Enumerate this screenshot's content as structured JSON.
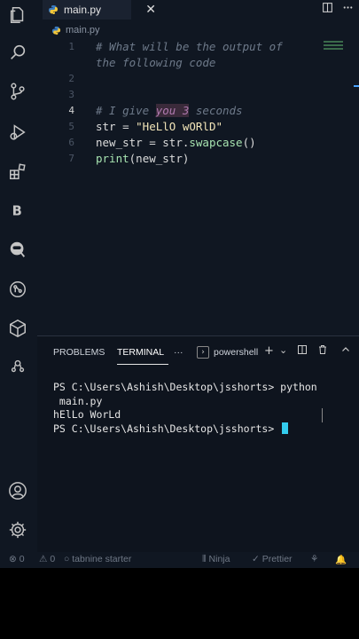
{
  "tab": {
    "filename": "main.py",
    "close_glyph": "✕"
  },
  "breadcrumb": {
    "file": "main.py"
  },
  "activity_icons": [
    "files-icon",
    "search-icon",
    "source-control-icon",
    "run-debug-icon",
    "extensions-icon",
    "bootstrap-icon",
    "ninja-icon",
    "git-graph-icon",
    "cube-icon",
    "docker-icon"
  ],
  "editor": {
    "lines": [
      {
        "num": "1",
        "comment": "# What will be the output of"
      },
      {
        "num": "",
        "comment": "the following code"
      },
      {
        "num": "2"
      },
      {
        "num": "3"
      },
      {
        "num": "4",
        "comment_a": "# I give ",
        "comment_b": "you 3",
        "comment_c": " seconds"
      },
      {
        "num": "5",
        "var": "str",
        "op": " = ",
        "string": "\"HeLlO wORlD\""
      },
      {
        "num": "6",
        "var": "new_str",
        "op": " = ",
        "obj": "str.",
        "method": "swapcase",
        "tail": "()"
      },
      {
        "num": "7",
        "fn": "print",
        "args": "(new_str)"
      }
    ]
  },
  "panel": {
    "tabs": {
      "problems": "PROBLEMS",
      "terminal": "TERMINAL",
      "more": "···"
    },
    "shell": "powershell",
    "shell_icon": "›",
    "buttons": {
      "add": "+",
      "dropdown": "⌄",
      "split": "◫",
      "trash": "🗑",
      "collapse": "⌃"
    }
  },
  "terminal": {
    "lines": [
      "PS C:\\Users\\Ashish\\Desktop\\jsshorts> python",
      " main.py",
      "hElLo WorLd",
      "PS C:\\Users\\Ashish\\Desktop\\jsshorts> "
    ]
  },
  "status": {
    "errors": "⊗ 0",
    "warnings": "⚠ 0",
    "tabnine": "○ tabnine starter",
    "ninja": "⦀ Ninja",
    "prettier": "✓ Prettier",
    "feedback": "⚘",
    "bell": "🔔"
  },
  "colors": {
    "accent": "#33ccee",
    "background": "#101722",
    "comment": "#6e7a8a",
    "string": "#f2e5b8"
  }
}
